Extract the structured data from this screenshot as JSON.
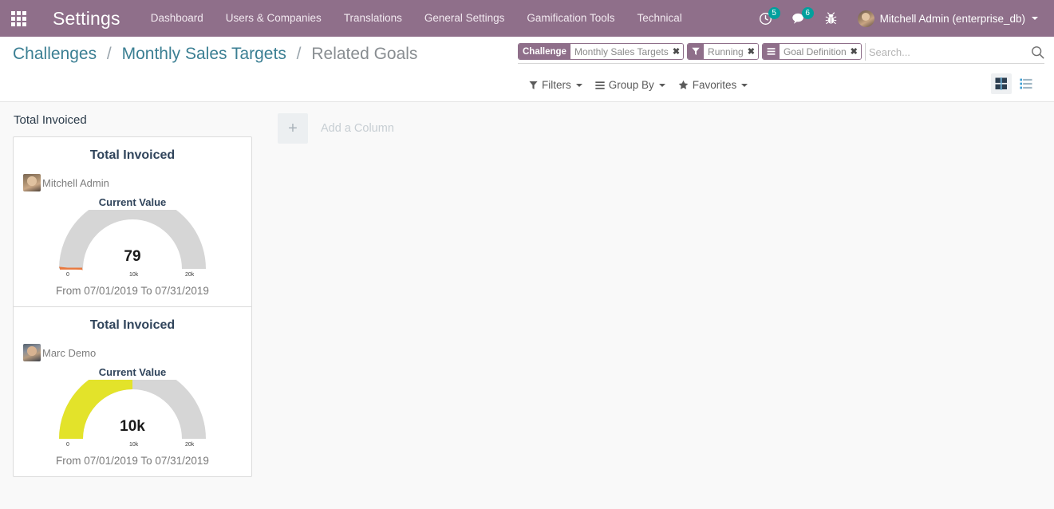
{
  "navbar": {
    "apps_icon": "apps-grid-icon",
    "brand": "Settings",
    "menu": [
      {
        "label": "Dashboard"
      },
      {
        "label": "Users & Companies"
      },
      {
        "label": "Translations"
      },
      {
        "label": "General Settings"
      },
      {
        "label": "Gamification Tools"
      },
      {
        "label": "Technical"
      }
    ],
    "activity_icon": "clock-activity-icon",
    "activity_count": "5",
    "messages_icon": "chat-bubble-icon",
    "messages_count": "6",
    "debug_icon": "bug-icon",
    "user_avatar": "user-avatar",
    "user_name": "Mitchell Admin (enterprise_db)",
    "user_caret": "chevron-down-icon",
    "colors": {
      "navbar_bg": "#8f6f8a",
      "badge_bg": "#00a09d"
    }
  },
  "breadcrumb": {
    "items": [
      {
        "label": "Challenges",
        "active": false
      },
      {
        "label": "Monthly Sales Targets",
        "active": false
      },
      {
        "label": "Related Goals",
        "active": true
      }
    ],
    "separator": "/"
  },
  "search": {
    "facets": [
      {
        "label": "Challenge",
        "icon": "",
        "value": "Monthly Sales Targets",
        "remove": "✖"
      },
      {
        "label": "",
        "icon": "filter-funnel-icon",
        "value": "Running",
        "remove": "✖"
      },
      {
        "label": "",
        "icon": "group-by-bars-icon",
        "value": "Goal Definition",
        "remove": "✖"
      }
    ],
    "placeholder": "Search...",
    "value": "",
    "search_icon": "magnifier-icon"
  },
  "controls": {
    "filters": {
      "label": "Filters",
      "icon": "filter-funnel-icon"
    },
    "groupby": {
      "label": "Group By",
      "icon": "group-by-bars-icon"
    },
    "favorites": {
      "label": "Favorites",
      "icon": "star-icon"
    },
    "views": [
      {
        "name": "kanban",
        "icon": "kanban-grid-icon",
        "active": true
      },
      {
        "name": "list",
        "icon": "list-view-icon",
        "active": false
      }
    ]
  },
  "kanban": {
    "column_title": "Total Invoiced",
    "add_column": {
      "plus": "+",
      "label": "Add a Column"
    },
    "cards": [
      {
        "title": "Total Invoiced",
        "user": "Mitchell Admin",
        "current_value_label": "Current Value",
        "value_display": "79",
        "range": "From 07/01/2019 To 07/31/2019"
      },
      {
        "title": "Total Invoiced",
        "user": "Marc Demo",
        "current_value_label": "Current Value",
        "value_display": "10k",
        "range": "From 07/01/2019 To 07/31/2019"
      }
    ]
  },
  "chart_data": [
    {
      "type": "gauge",
      "title": "Current Value",
      "label": "Total Invoiced — Mitchell Admin",
      "value": 79,
      "value_display": "79",
      "min": 0,
      "max": 20000,
      "ticks": [
        "0",
        "10k",
        "20k"
      ],
      "tick_values": [
        0,
        10000,
        20000
      ],
      "fill_fraction": 0.004,
      "fill_color": "#e8793f",
      "track_color": "#d6d6d6"
    },
    {
      "type": "gauge",
      "title": "Current Value",
      "label": "Total Invoiced — Marc Demo",
      "value": 10000,
      "value_display": "10k",
      "min": 0,
      "max": 20000,
      "ticks": [
        "0",
        "10k",
        "20k"
      ],
      "tick_values": [
        0,
        10000,
        20000
      ],
      "fill_fraction": 0.5,
      "fill_color": "#e3e32a",
      "track_color": "#d6d6d6"
    }
  ]
}
